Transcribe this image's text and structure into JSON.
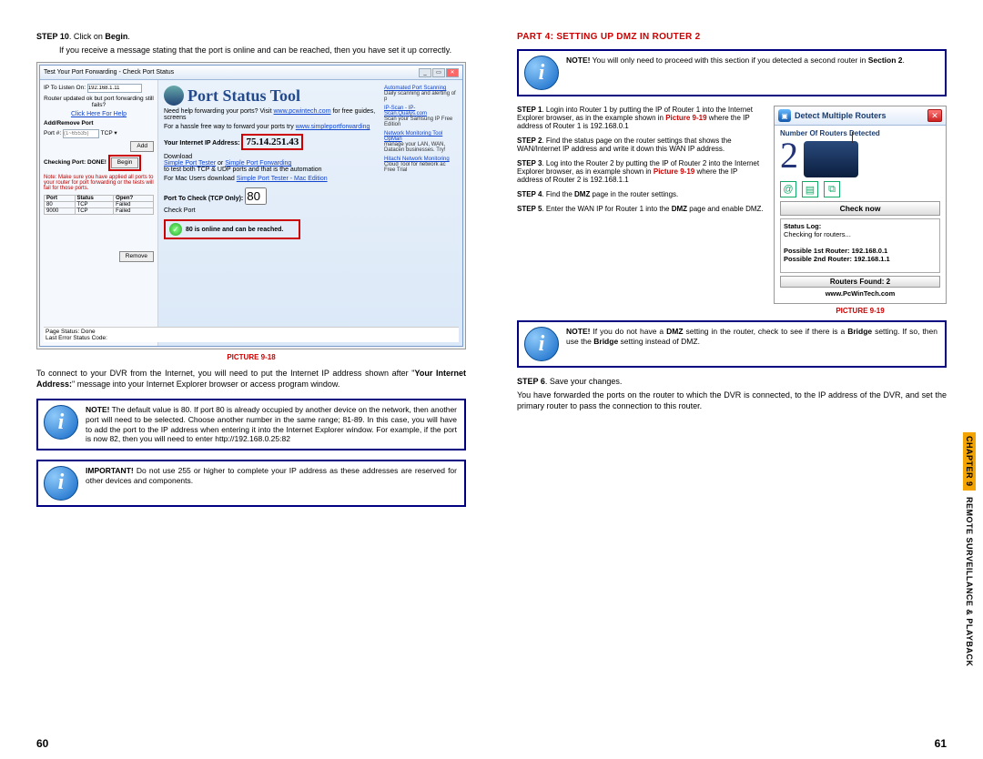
{
  "left": {
    "step10_label": "STEP 10",
    "step10_text": ". Click on ",
    "step10_bold": "Begin",
    "step10_tail": ".",
    "step10_sub": "If you receive a message stating that the port is online and can be reached, then you have set it up correctly.",
    "win_title": "Test Your Port Forwarding - Check Port Status",
    "ip_listen_label": "IP To Listen On:",
    "ip_listen_val": "192.168.1.11",
    "router_q": "Router updated ok but port forwarding still fails?",
    "help_link": "Click Here For Help",
    "add_remove": "Add/Remove Port",
    "port_label": "Port #:",
    "port_range": "(1~65535)",
    "tcp": "TCP",
    "add_btn": "Add",
    "checking_label": "Checking Port: DONE!",
    "begin_btn": "Begin",
    "left_note": "Note: Make sure you have applied all ports to your router for port forwarding or the tests will fail for those ports.",
    "tbl_h1": "Port",
    "tbl_h2": "Status",
    "tbl_h3": "Open?",
    "tbl_r1_p": "80",
    "tbl_r1_s": "TCP",
    "tbl_r1_o": "Failed",
    "tbl_r2_p": "9000",
    "tbl_r2_s": "TCP",
    "tbl_r2_o": "Failed",
    "remove_btn": "Remove",
    "pst_title": "Port Status Tool",
    "pst_help": "Need help forwarding your ports? Visit ",
    "pst_site": "www.pcwintech.com",
    "pst_help2": " for free guides, screens",
    "pst_hassle": "For a hassle free way to forward your ports try ",
    "pst_spf": "www.simpleportforwarding",
    "yia_label": "Your Internet IP Address:",
    "yia_val": "75.14.251.43",
    "download": "Download",
    "spt": "Simple Port Tester",
    "or": " or ",
    "spf2": "Simple Port Forwarding",
    "tcudp": "to test both TCP & UDP ports and that is the automation",
    "mac": "For Mac Users download ",
    "macl": "Simple Port Tester - Mac Edition",
    "ptc": "Port To Check (TCP Only):",
    "ptc_val": "80",
    "checkport": "Check Port",
    "online_msg": "80 is online and can be reached.",
    "ad1_t": "Automated Port Scanning",
    "ad1_b": "Daily scanning and alerting of p",
    "ad2_t": "IP-Scan - IP-Scan.Qualys.com",
    "ad2_b": "Scan your Samsung IP Free Edition",
    "ad3_t": "Network Monitoring Tool OpMan",
    "ad3_b": "manage your LAN, WAN, Datacen businesses. Try!",
    "ad4_t": "Hitachi Network Monitoring",
    "ad4_b": "Cloud Tool for network ac Free Trial",
    "page_status": "Page Status: Done",
    "last_err": "Last Error Status Code:",
    "caption": "PICTURE 9-18",
    "para1_a": "To connect to your DVR from the Internet, you will need to put the Internet IP address shown after \"",
    "para1_b": "Your Internet Address:",
    "para1_c": "\" message into your Internet Explorer browser or access program window.",
    "note1_label": "NOTE!",
    "note1_body": " The default value is 80. If port 80 is already occupied by another device on the network, then another port will need to be selected. Choose another number in the same range; 81-89. In this case, you will have to add the port to the IP address when entering it into the Internet Explorer window. For example, if the port is now 82, then you will need to enter http://192.168.0.25:82",
    "note2_label": "IMPORTANT!",
    "note2_body": " Do not use 255 or higher to complete your IP address as these addresses are reserved for other devices and components.",
    "pagenum": "60"
  },
  "right": {
    "part_title": "PART 4: SETTING UP DMZ IN ROUTER 2",
    "noteA_label": "NOTE!",
    "noteA_body": " You will only need to proceed with this section if you detected a second router in ",
    "noteA_bold": "Section 2",
    "noteA_tail": ".",
    "s1_l": "STEP 1",
    "s1_t": ". Login into Router 1 by putting the IP of Router 1 into the Internet Explorer browser, as in the example shown in ",
    "s1_p": "Picture 9-19",
    "s1_t2": " where the IP address of Router 1 is 192.168.0.1",
    "s2_l": "STEP 2",
    "s2_t": ". Find the status page on the router settings that shows the WAN/Internet IP address and  write it down this WAN IP address.",
    "s3_l": "STEP 3",
    "s3_t": ". Log into the Router 2 by putting the IP of Router 2 into the Internet Explorer browser, as in example shown in ",
    "s3_p": "Picture 9-19",
    "s3_t2": " where the IP address of Router 2 is  192.168.1.1",
    "s4_l": "STEP 4",
    "s4_t": ". Find the ",
    "s4_b": "DMZ",
    "s4_t2": " page in the router settings.",
    "s5_l": "STEP 5",
    "s5_t": ". Enter the WAN IP for Router 1 into the ",
    "s5_b": "DMZ",
    "s5_t2": " page and enable DMZ.",
    "dmr_title": "Detect Multiple Routers",
    "dmr_sub": "Number Of Routers Detected",
    "dmr_num": "2",
    "check_now": "Check now",
    "stat_h": "Status Log:",
    "stat_1": "Checking for routers...",
    "stat_2": "Possible 1st Router: 192.168.0.1",
    "stat_3": "Possible 2nd Router: 192.168.1.1",
    "rf": "Routers Found: 2",
    "dmr_site": "www.PcWinTech.com",
    "caption2": "PICTURE 9-19",
    "noteB_label": "NOTE!",
    "noteB_a": "  If you do not have a ",
    "noteB_b1": "DMZ",
    "noteB_b": " setting in the router, check to see if there is a ",
    "noteB_b2": "Bridge",
    "noteB_c": " setting. If so, then use the ",
    "noteB_b3": "Bridge",
    "noteB_d": " setting instead of DMZ.",
    "s6_l": "STEP 6",
    "s6_t": ". Save your changes.",
    "para2": "You have forwarded the ports on the router to which the DVR is connected, to the IP address of the DVR, and set the primary router to pass the connection to this router.",
    "chapter": "CHAPTER 9",
    "rest": " REMOTE SURVEILLANCE & PLAYBACK",
    "pagenum": "61"
  }
}
